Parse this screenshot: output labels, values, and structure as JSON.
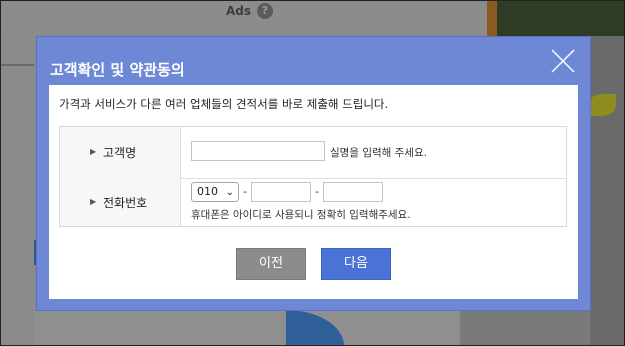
{
  "background": {
    "ads_label": "Ads",
    "ads_help": "?"
  },
  "modal": {
    "title": "고객확인 및 약관동의",
    "intro": "가격과 서비스가 다른 여러 업체들의 견적서를 바로 제출해 드립니다.",
    "name_row": {
      "label": "고객명",
      "input_value": "",
      "hint": "실명을 입력해 주세요."
    },
    "phone_row": {
      "label": "전화번호",
      "prefix_selected": "010",
      "separator": "-",
      "middle_value": "",
      "last_value": "",
      "hint": "휴대폰은 아이디로 사용되니 정확히 입력해주세요."
    },
    "buttons": {
      "prev": "이전",
      "next": "다음"
    },
    "colors": {
      "header": "#6f88d6",
      "next_button": "#4a73d8",
      "prev_button": "#8c8c8c"
    }
  }
}
